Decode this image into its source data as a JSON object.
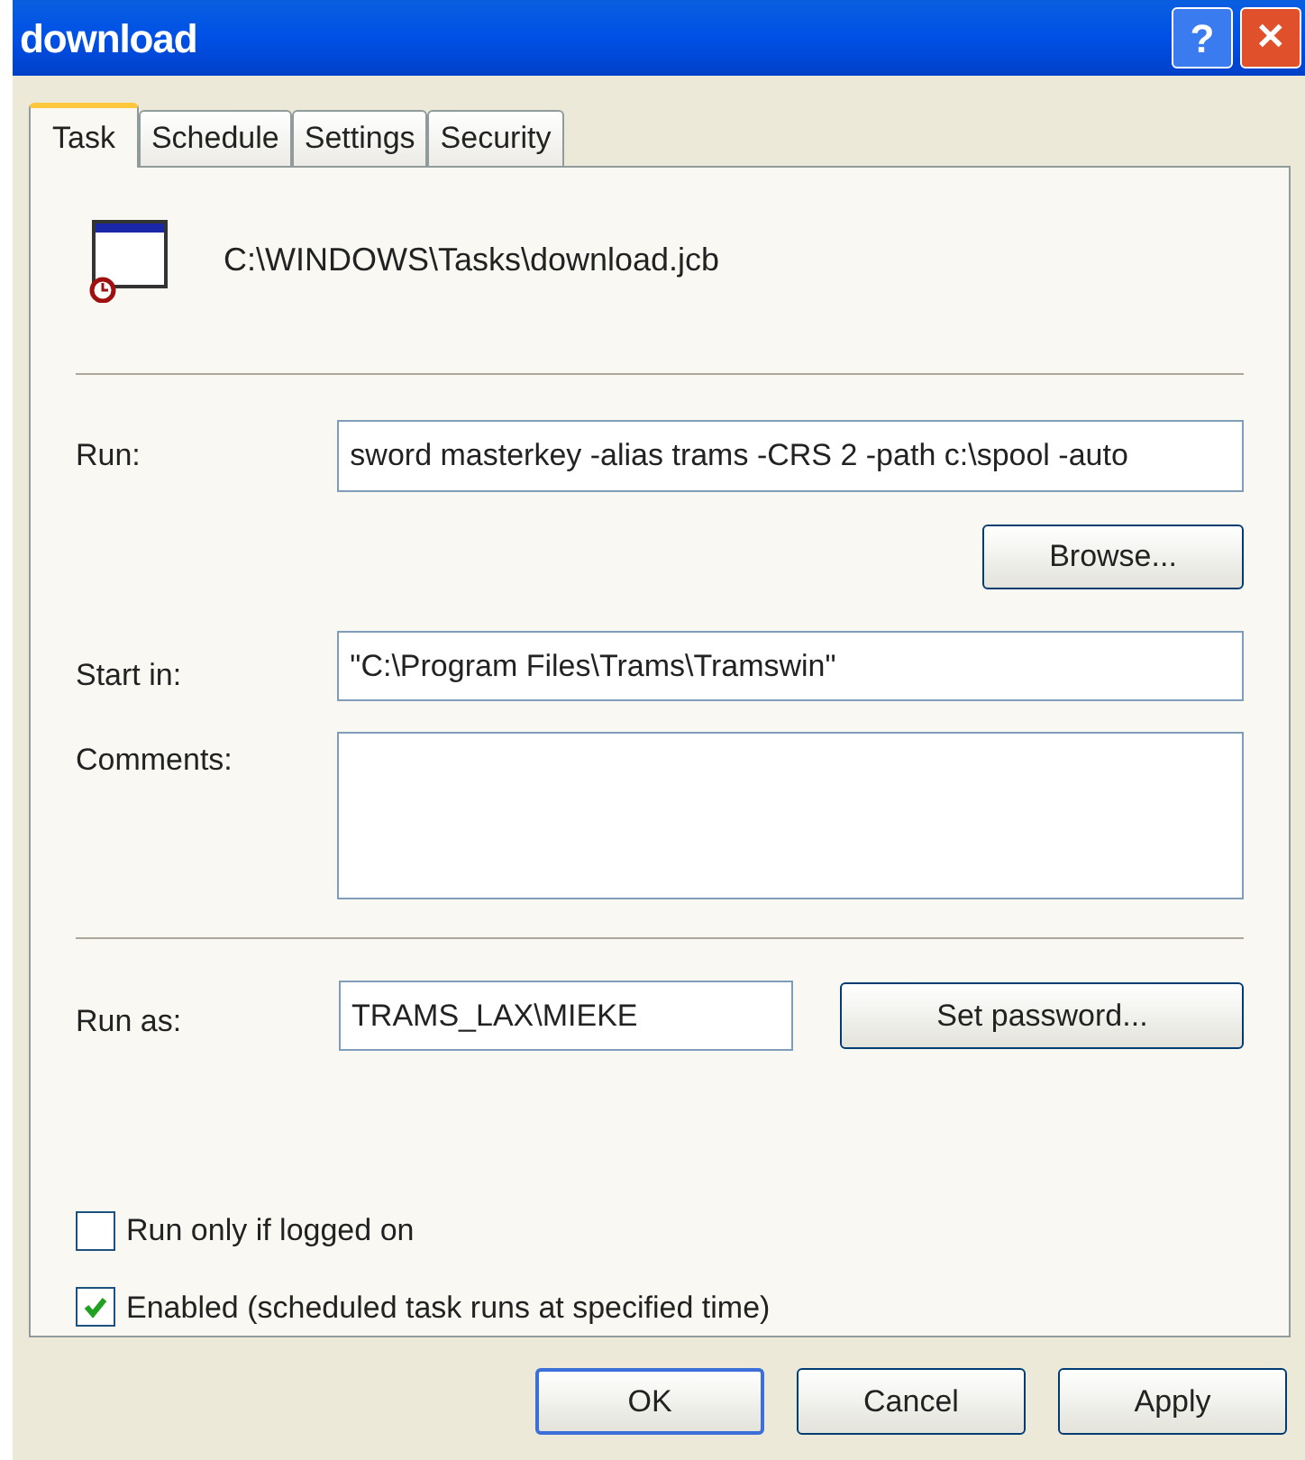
{
  "window": {
    "title": "download"
  },
  "title_buttons": [
    {
      "kind": "help",
      "label": "?"
    },
    {
      "kind": "close",
      "label": "✕"
    }
  ],
  "tabs": [
    {
      "label": "Task",
      "selected": true
    },
    {
      "label": "Schedule",
      "selected": false
    },
    {
      "label": "Settings",
      "selected": false
    },
    {
      "label": "Security",
      "selected": false
    }
  ],
  "task_path": "C:\\WINDOWS\\Tasks\\download.jcb",
  "run": {
    "label": "Run:",
    "value": "sword masterkey -alias trams -CRS 2 -path c:\\spool -auto",
    "button": "Browse..."
  },
  "start_in": {
    "label": "Start in:",
    "value": "\"C:\\Program Files\\Trams\\Tramswin\""
  },
  "comments": {
    "label": "Comments:"
  },
  "run_as": {
    "label": "Run as:",
    "value": "TRAMS_LAX\\MIEKE",
    "button": "Set password..."
  },
  "options": [
    {
      "label": "Run only if logged on",
      "checked": false
    },
    {
      "label": "Enabled (scheduled task runs at specified time)",
      "checked": true
    }
  ],
  "buttons": [
    {
      "label": "OK",
      "default": true
    },
    {
      "label": "Cancel",
      "default": false
    },
    {
      "label": "Apply",
      "default": false
    }
  ]
}
